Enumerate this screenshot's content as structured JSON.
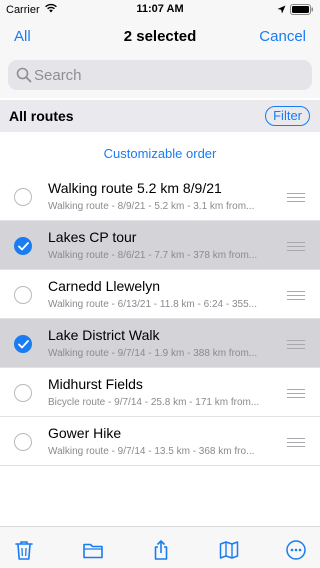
{
  "status": {
    "carrier": "Carrier",
    "time": "11:07 AM"
  },
  "nav": {
    "left": "All",
    "title": "2 selected",
    "right": "Cancel"
  },
  "search": {
    "placeholder": "Search"
  },
  "section": {
    "title": "All routes",
    "filter": "Filter"
  },
  "order_link": "Customizable order",
  "routes": [
    {
      "title": "Walking route 5.2 km 8/9/21",
      "subtitle": "Walking route - 8/9/21 - 5.2 km - 3.1 km from...",
      "selected": false
    },
    {
      "title": "Lakes CP tour",
      "subtitle": "Walking route - 8/6/21 - 7.7 km - 378 km from...",
      "selected": true
    },
    {
      "title": "Carnedd Llewelyn",
      "subtitle": "Walking route - 6/13/21 - 11.8 km - 6:24 - 355...",
      "selected": false
    },
    {
      "title": "Lake District Walk",
      "subtitle": "Walking route - 9/7/14 - 1.9 km - 388 km from...",
      "selected": true
    },
    {
      "title": "Midhurst Fields",
      "subtitle": "Bicycle route - 9/7/14 - 25.8 km - 171 km from...",
      "selected": false
    },
    {
      "title": "Gower Hike",
      "subtitle": "Walking route - 9/7/14 - 13.5 km - 368 km fro...",
      "selected": false
    }
  ],
  "toolbar": {
    "icons": [
      "trash-icon",
      "folder-icon",
      "share-icon",
      "map-icon",
      "more-icon"
    ]
  },
  "colors": {
    "accent": "#1a7cf2",
    "selected_row": "#d4d4d8"
  }
}
